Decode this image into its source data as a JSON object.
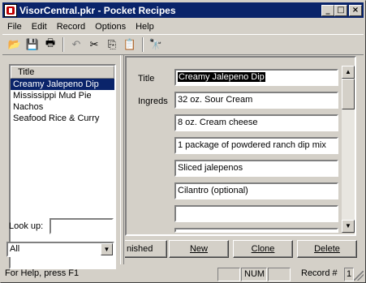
{
  "window": {
    "title": "VisorCentral.pkr - Pocket Recipes",
    "minimize_icon": "_",
    "maximize_icon": "□",
    "close_icon": "×"
  },
  "menu": [
    "File",
    "Edit",
    "Record",
    "Options",
    "Help"
  ],
  "toolbar": {
    "icons": [
      "open-folder-icon",
      "save-icon",
      "print-icon",
      "undo-icon",
      "cut-icon",
      "copy-icon",
      "paste-icon",
      "find-icon"
    ],
    "glyphs": {
      "open": "📂",
      "save": "💾",
      "print": "🖶",
      "undo": "↶",
      "cut": "✂",
      "copy": "⎘",
      "paste": "📋",
      "find": "🔭"
    }
  },
  "recipe_list": {
    "header": "Title",
    "items": [
      "Creamy Jalepeno Dip",
      "Mississippi Mud Pie",
      "Nachos",
      "Seafood Rice & Curry"
    ],
    "selected_index": 0
  },
  "lookup": {
    "label": "Look up:",
    "value": ""
  },
  "category": {
    "selected": "All",
    "arrow": "▼"
  },
  "record": {
    "title_label": "Title",
    "title_value": "Creamy Jalepeno Dip",
    "ingredients_label": "Ingreds",
    "ingredients": [
      "32 oz. Sour Cream",
      "8 oz. Cream cheese",
      "1 package of powdered ranch dip mix",
      "Sliced jalepenos",
      "Cilantro (optional)",
      "",
      ""
    ]
  },
  "scrollbar": {
    "up": "▲",
    "down": "▼"
  },
  "buttons": {
    "finished": "nished",
    "new": "New",
    "clone": "Clone",
    "delete": "Delete"
  },
  "status": {
    "help": "For Help, press F1",
    "num": "NUM",
    "record_label": "Record #",
    "record_number": "1"
  }
}
